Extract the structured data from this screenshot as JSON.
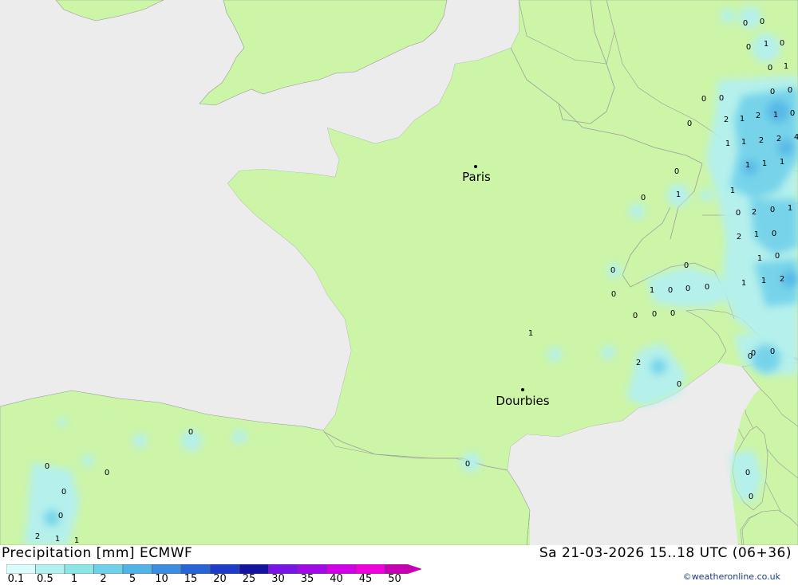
{
  "map": {
    "cities": [
      {
        "name": "Paris"
      },
      {
        "name": "Dourbies"
      }
    ],
    "values": [
      "0",
      "0",
      "0",
      "1",
      "0",
      "0",
      "1",
      "0",
      "0",
      "0",
      "0",
      "2",
      "1",
      "2",
      "1",
      "0",
      "0",
      "1",
      "1",
      "2",
      "2",
      "4",
      "1",
      "1",
      "1",
      "1",
      "2",
      "0",
      "1",
      "0",
      "2",
      "1",
      "0",
      "1",
      "0",
      "1",
      "1",
      "2",
      "0",
      "0",
      "1",
      "0",
      "0",
      "1",
      "0",
      "0",
      "0",
      "0",
      "0",
      "0",
      "0",
      "1",
      "2",
      "0",
      "0",
      "0",
      "0",
      "0",
      "0",
      "0",
      "0",
      "2",
      "1",
      "1",
      "0",
      "0",
      "0",
      "0"
    ],
    "colors": {
      "sea": "#ececec",
      "land": "#ccf5a8",
      "border": "#999999"
    }
  },
  "footer": {
    "title": "Precipitation [mm] ECMWF",
    "valid_time": "Sa 21-03-2026 15..18 UTC (06+36)",
    "credit": "©weatheronline.co.uk"
  },
  "legend": {
    "labels": [
      "0.1",
      "0.5",
      "1",
      "2",
      "5",
      "10",
      "15",
      "20",
      "25",
      "30",
      "35",
      "40",
      "45",
      "50"
    ],
    "colors": [
      "#dcfcfc",
      "#b4f0f0",
      "#8ce6e6",
      "#6fd0ea",
      "#52b4e6",
      "#3c8ce0",
      "#2864d6",
      "#1e3cc8",
      "#1414a0",
      "#7814e6",
      "#a00ae6",
      "#d200e6",
      "#f000dc",
      "#c800b4"
    ]
  }
}
